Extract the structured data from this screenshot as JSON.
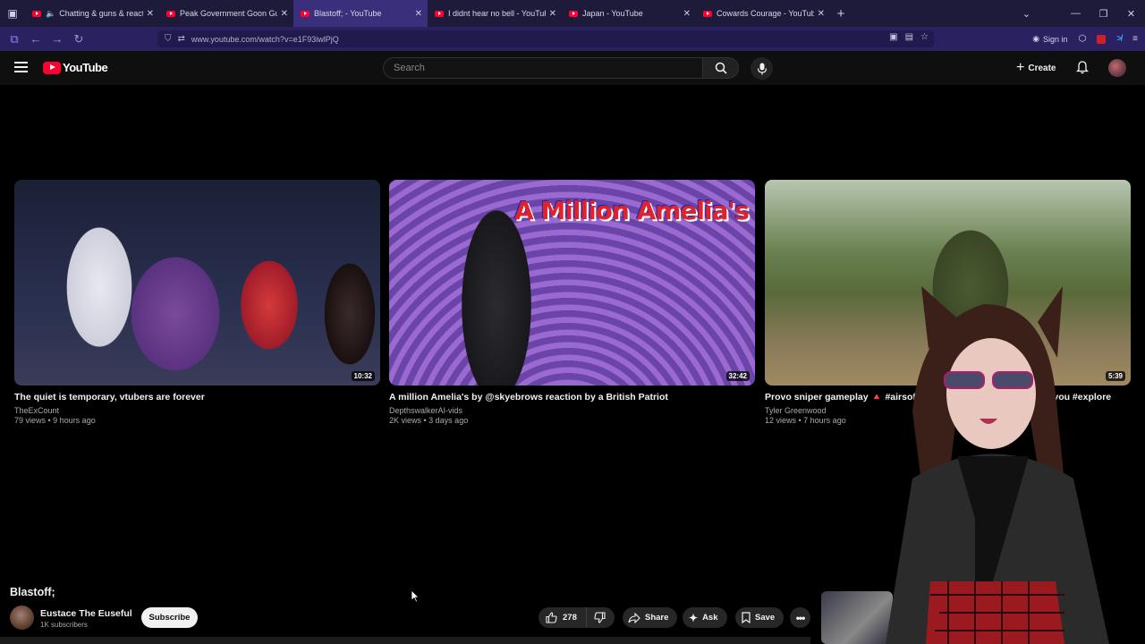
{
  "browser": {
    "tabs": [
      {
        "title": "Chatting & guns & reacts! |",
        "audio": true,
        "active": false
      },
      {
        "title": "Peak Government Goon Gun? ||",
        "audio": false,
        "active": false
      },
      {
        "title": "Blastoff; - YouTube",
        "audio": false,
        "active": true
      },
      {
        "title": "I didnt hear no bell - YouTube",
        "audio": false,
        "active": false
      },
      {
        "title": "Japan - YouTube",
        "audio": false,
        "active": false
      },
      {
        "title": "Cowards Courage - YouTube",
        "audio": false,
        "active": false
      }
    ],
    "url": "www.youtube.com/watch?v=e1F93iwlPjQ",
    "sign_in": "Sign in"
  },
  "youtube": {
    "logo_text": "YouTube",
    "search_placeholder": "Search",
    "create_label": "Create"
  },
  "end_screen": [
    {
      "title": "The quiet is temporary, vtubers are forever",
      "channel": "TheExCount",
      "meta": "79 views • 9 hours ago",
      "duration": "10:32"
    },
    {
      "title": "A million Amelia's by @skyebrows reaction by a British Patriot",
      "channel": "DepthswalkerAI-vids",
      "meta": "2K views • 3 days ago",
      "duration": "32:42",
      "banner": "A Million Amelia's"
    },
    {
      "title": "Provo sniper gameplay 🔺 #airsoft #air… #fyp #explorepage #foryou #explore",
      "channel": "Tyler Greenwood",
      "meta": "12 views • 7 hours ago",
      "duration": "5:39"
    }
  ],
  "video": {
    "title": "Blastoff;",
    "channel": "Eustace The Euseful",
    "subscribers": "1K subscribers",
    "subscribe_label": "Subscribe",
    "likes": "278",
    "share_label": "Share",
    "ask_label": "Ask",
    "save_label": "Save"
  },
  "colors": {
    "brand": "#ff0033",
    "tab_active": "#3a2f7a",
    "tabbar": "#1d1a3a"
  }
}
